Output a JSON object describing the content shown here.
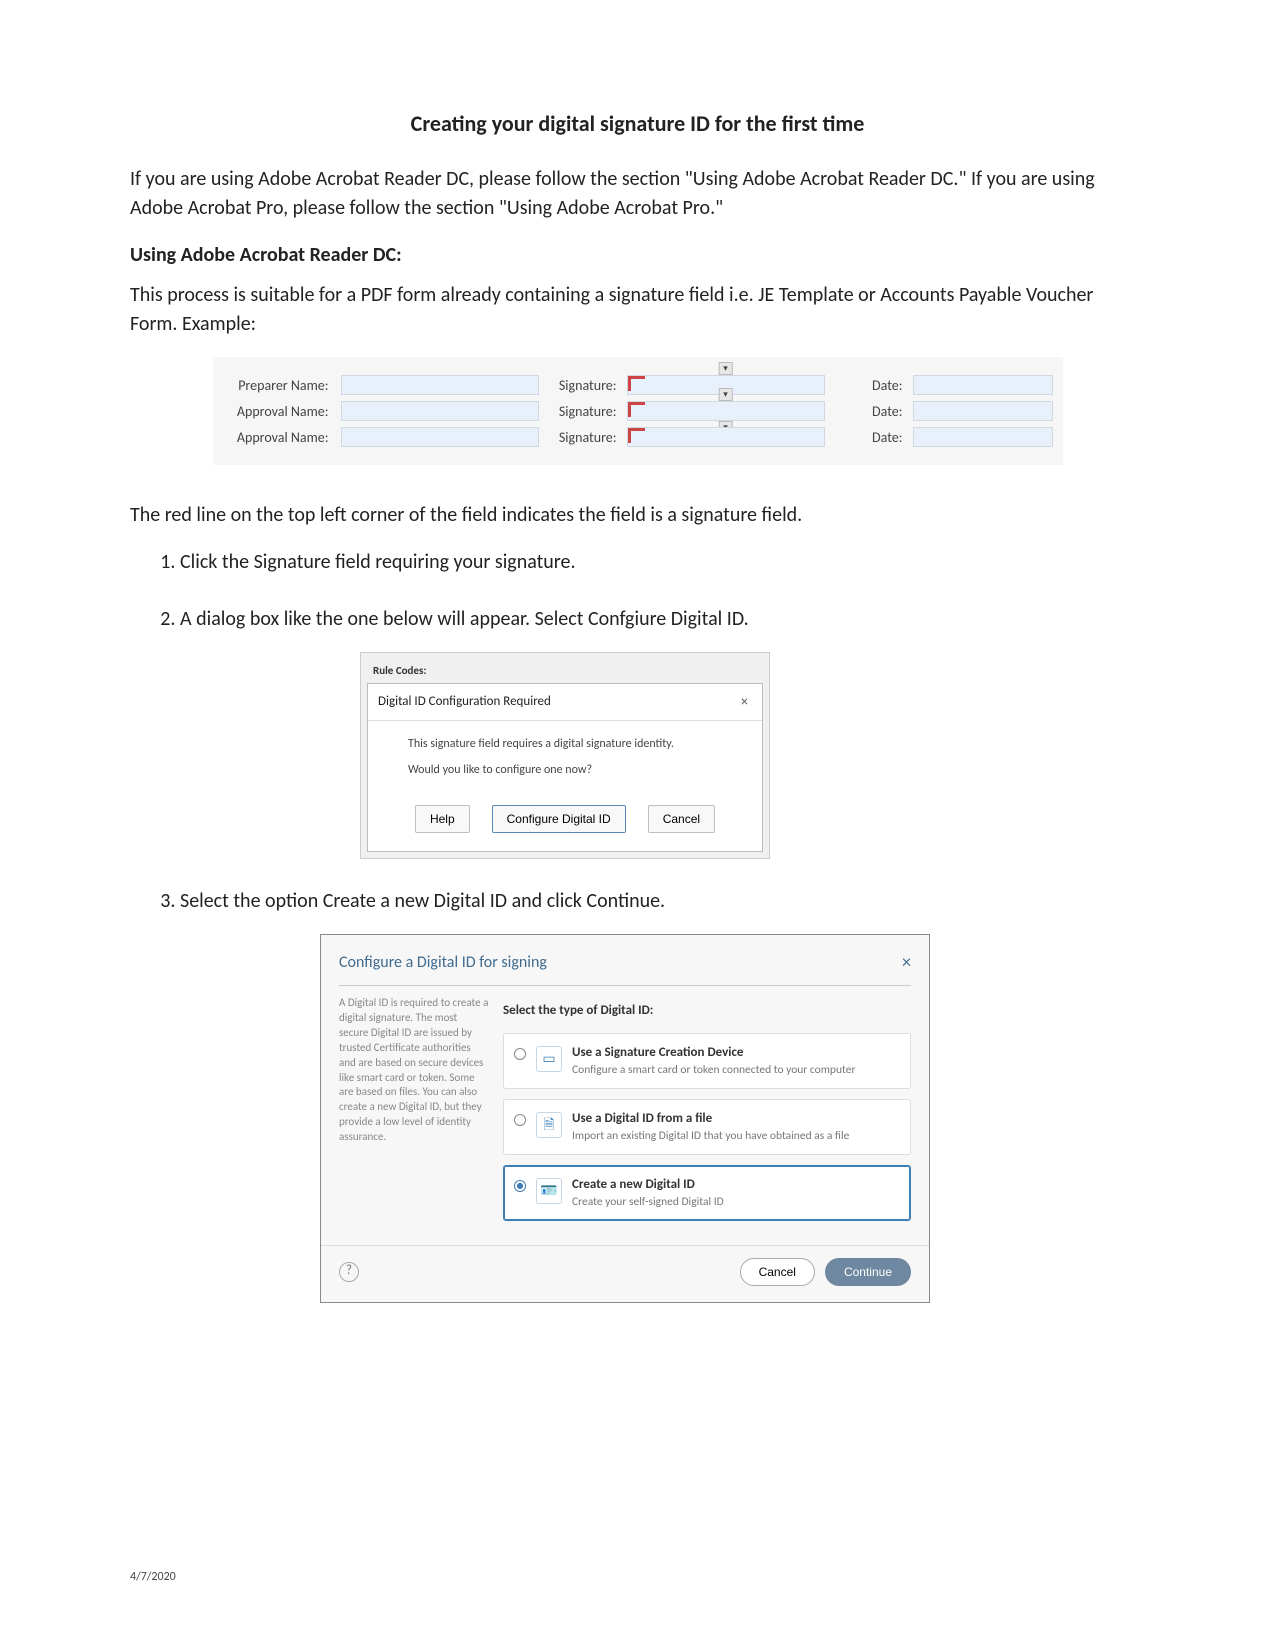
{
  "title": "Creating your digital signature ID for the first time",
  "intro": "If you are using Adobe Acrobat Reader DC, please follow the section \"Using Adobe Acrobat Reader DC.\" If you are using Adobe Acrobat Pro, please follow the section \"Using Adobe Acrobat Pro.\"",
  "section1_title": "Using Adobe Acrobat Reader DC:",
  "section1_body": "This process is suitable for a PDF form already containing a signature field i.e. JE Template or Accounts Payable Voucher Form. Example:",
  "fields": {
    "rows": [
      {
        "name": "Preparer Name:",
        "sig": "Signature:",
        "date": "Date:"
      },
      {
        "name": "Approval Name:",
        "sig": "Signature:",
        "date": "Date:"
      },
      {
        "name": "Approval Name:",
        "sig": "Signature:",
        "date": "Date:"
      }
    ]
  },
  "redline_text": "The red line on the top left corner of the field indicates the field is a signature field.",
  "steps": [
    "Click the Signature field requiring your signature.",
    "A dialog box like the one below will appear. Select Confgiure Digital ID.",
    "Select the option Create a new Digital ID and click Continue."
  ],
  "dlg1": {
    "caption": "Rule Codes:",
    "title": "Digital ID Configuration Required",
    "line1": "This signature field requires a digital signature identity.",
    "line2": "Would you like to configure one now?",
    "help": "Help",
    "configure": "Configure Digital ID",
    "cancel": "Cancel"
  },
  "dlg2": {
    "title": "Configure a Digital ID for signing",
    "side_text": "A Digital ID is required to create a digital signature. The most secure Digital ID are issued by trusted Certificate authorities and are based on secure devices like smart card or token. Some are based on files.\n\nYou can also create a new Digital ID, but they provide a low level of identity assurance.",
    "subtitle": "Select the type of Digital ID:",
    "options": [
      {
        "title": "Use a Signature Creation Device",
        "desc": "Configure a smart card or token connected to your computer"
      },
      {
        "title": "Use a Digital ID from a file",
        "desc": "Import an existing Digital ID that you have obtained as a file"
      },
      {
        "title": "Create a new Digital ID",
        "desc": "Create your self-signed Digital ID"
      }
    ],
    "cancel": "Cancel",
    "continue": "Continue"
  },
  "footer_date": "4/7/2020"
}
